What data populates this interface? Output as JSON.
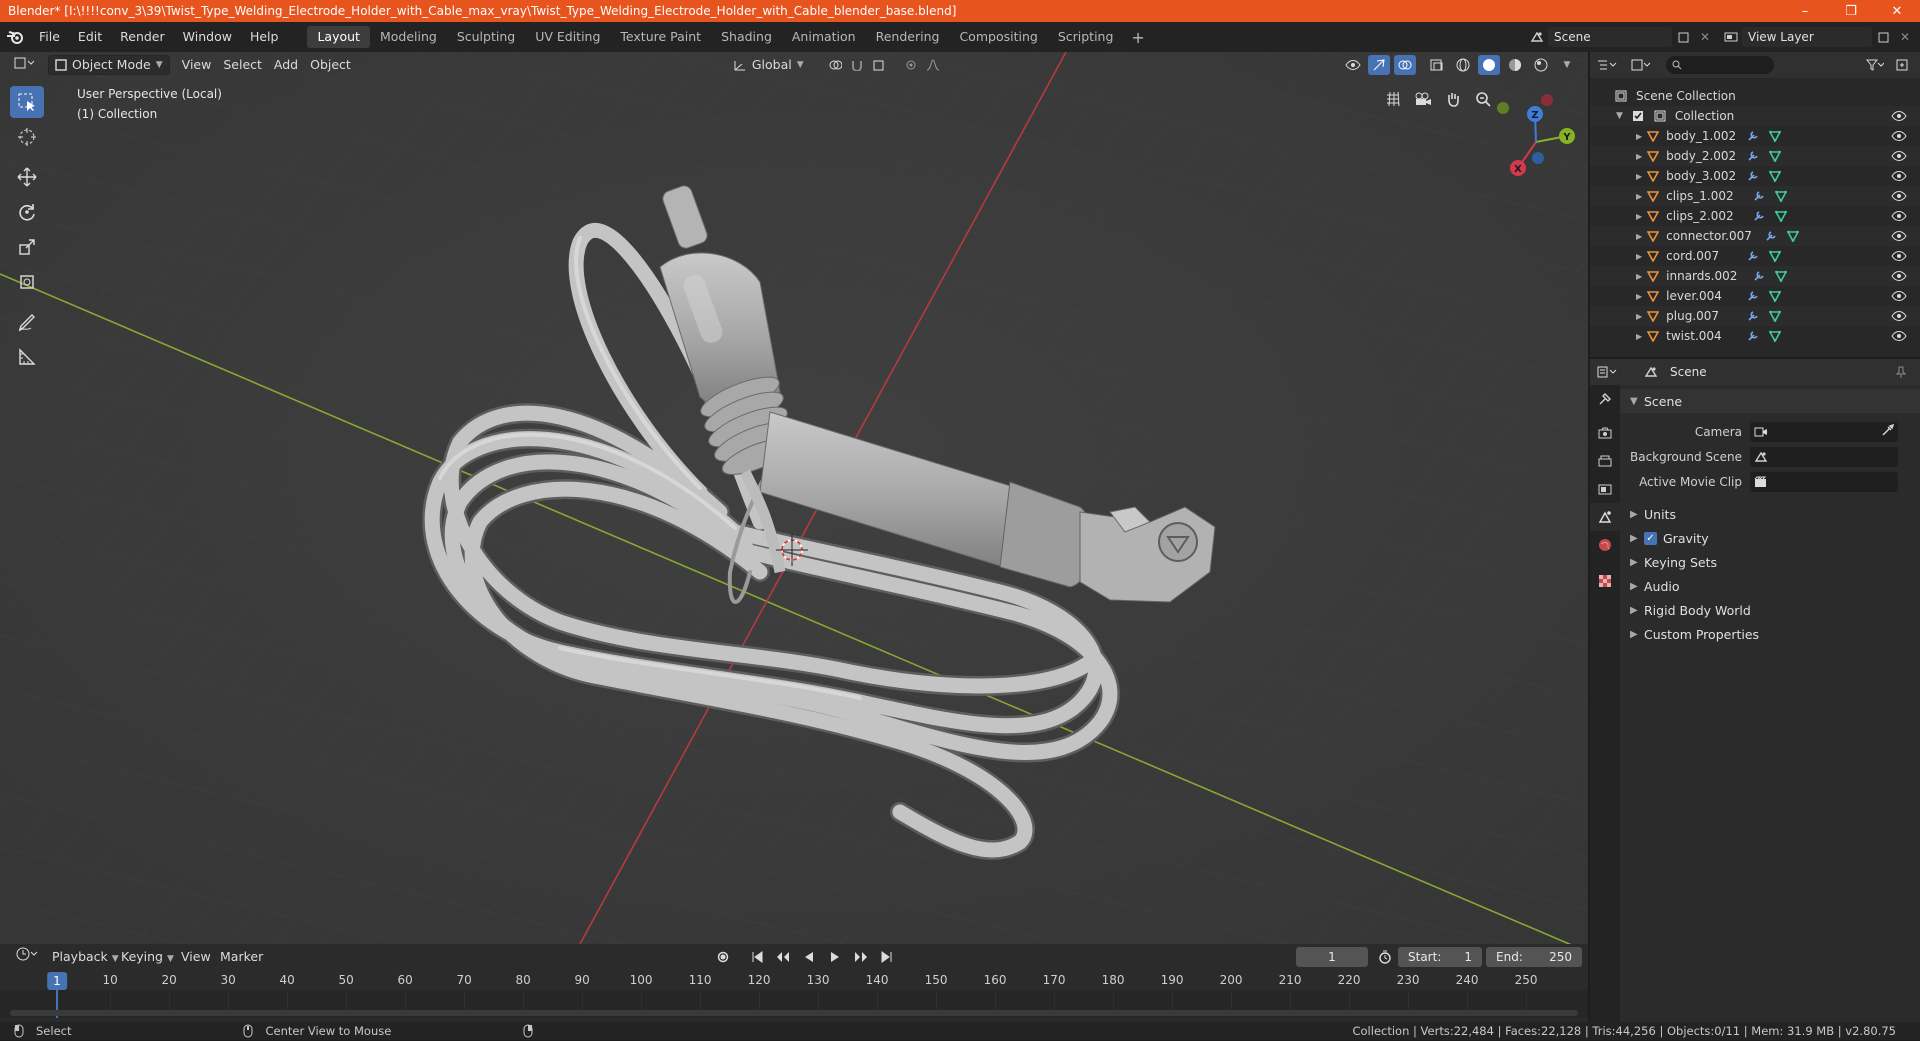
{
  "titlebar": {
    "title": "Blender* [I:\\!!!!conv_3\\39\\Twist_Type_Welding_Electrode_Holder_with_Cable_max_vray\\Twist_Type_Welding_Electrode_Holder_with_Cable_blender_base.blend]",
    "minimize": "–",
    "restore": "❐",
    "close": "✕"
  },
  "menu": {
    "file": "File",
    "edit": "Edit",
    "render": "Render",
    "window": "Window",
    "help": "Help"
  },
  "workspaces": [
    "Layout",
    "Modeling",
    "Sculpting",
    "UV Editing",
    "Texture Paint",
    "Shading",
    "Animation",
    "Rendering",
    "Compositing",
    "Scripting"
  ],
  "workspace_active": "Layout",
  "scene_selector": {
    "value": "Scene"
  },
  "viewlayer_selector": {
    "value": "View Layer"
  },
  "viewport": {
    "mode": "Object Mode",
    "menus": {
      "view": "View",
      "select": "Select",
      "add": "Add",
      "object": "Object"
    },
    "transform_orientation": "Global",
    "info_line1": "User Perspective (Local)",
    "info_line2": "(1) Collection"
  },
  "outliner": {
    "root": "Scene Collection",
    "collection": "Collection",
    "objects": [
      "body_1.002",
      "body_2.002",
      "body_3.002",
      "clips_1.002",
      "clips_2.002",
      "connector.007",
      "cord.007",
      "innards.002",
      "lever.004",
      "plug.007",
      "twist.004"
    ]
  },
  "properties": {
    "header_title": "Scene",
    "panel_scene": "Scene",
    "camera_label": "Camera",
    "background_scene_label": "Background Scene",
    "active_movie_clip_label": "Active Movie Clip",
    "units": "Units",
    "gravity": "Gravity",
    "keying_sets": "Keying Sets",
    "audio": "Audio",
    "rigid_body_world": "Rigid Body World",
    "custom_properties": "Custom Properties"
  },
  "timeline": {
    "playback": "Playback",
    "keying": "Keying",
    "view": "View",
    "marker": "Marker",
    "current_frame": "1",
    "start_label": "Start:",
    "start_value": "1",
    "end_label": "End:",
    "end_value": "250",
    "ruler": [
      "1",
      "10",
      "20",
      "30",
      "40",
      "50",
      "60",
      "70",
      "80",
      "90",
      "100",
      "110",
      "120",
      "130",
      "140",
      "150",
      "160",
      "170",
      "180",
      "190",
      "200",
      "210",
      "220",
      "230",
      "240",
      "250"
    ]
  },
  "statusbar": {
    "select": "Select",
    "center_view": "Center View to Mouse",
    "stats": "Collection | Verts:22,484 | Faces:22,128 | Tris:44,256 | Objects:0/11 | Mem: 31.9 MB | v2.80.75"
  },
  "gizmo": {
    "x": "X",
    "y": "Y",
    "z": "Z"
  },
  "colors": {
    "accent": "#4772b3",
    "titlebar": "#e8541d",
    "axis_x": "#d03a4b",
    "axis_y": "#89b126",
    "axis_z": "#3c7fdb",
    "object_orange": "#e8913a",
    "mesh_green": "#3ec9a0",
    "modifier_blue": "#7ba4e6"
  }
}
